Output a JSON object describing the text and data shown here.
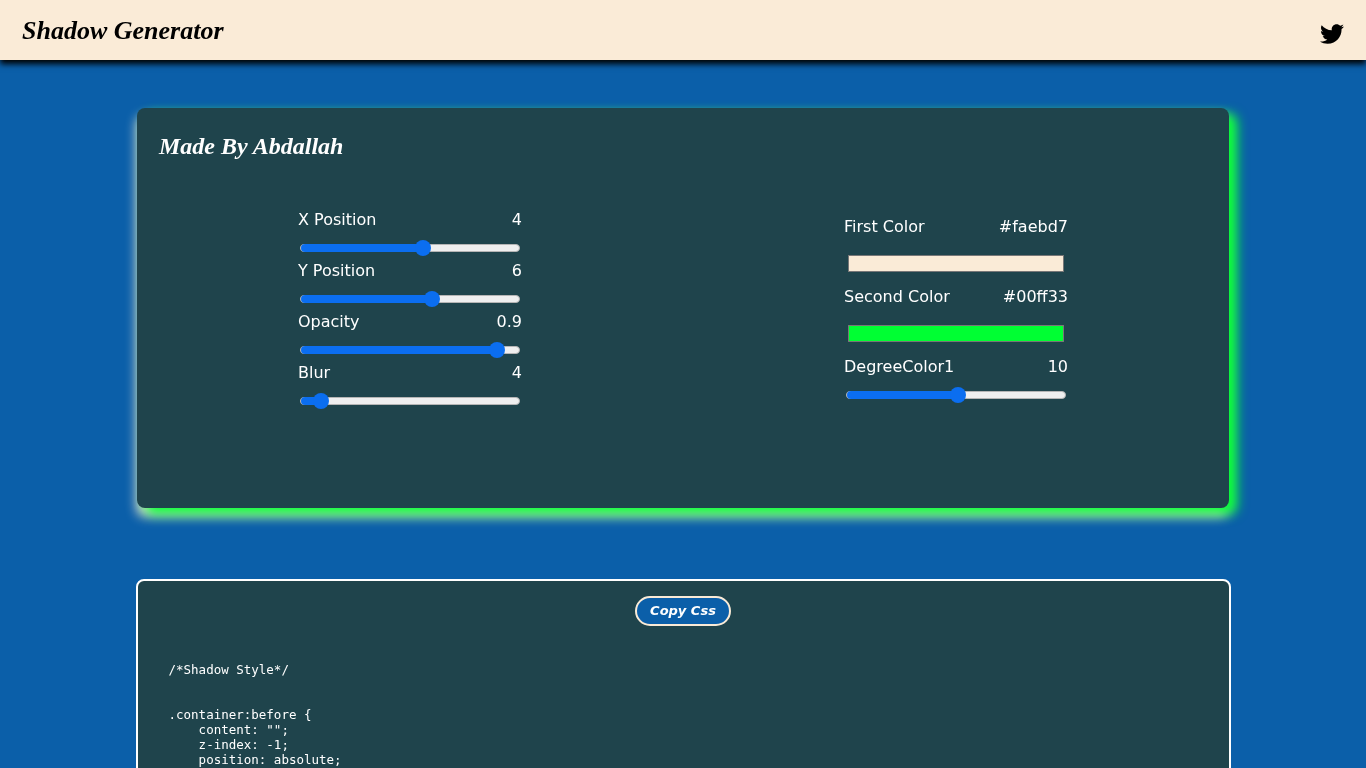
{
  "header": {
    "title": "Shadow Generator"
  },
  "card": {
    "title": "Made By Abdallah",
    "sliders": [
      {
        "label": "X Position",
        "reading": "4",
        "level": 0.56
      },
      {
        "label": "Y Position",
        "reading": "6",
        "level": 0.6
      },
      {
        "label": "Opacity",
        "reading": "0.9",
        "level": 0.9
      },
      {
        "label": "Blur",
        "reading": "4",
        "level": 0.09
      }
    ],
    "controls": [
      {
        "kind": "color",
        "label": "First Color",
        "reading": "#faebd7",
        "color": "#faebd7"
      },
      {
        "kind": "color",
        "label": "Second Color",
        "reading": "#00ff33",
        "color": "#00ff33"
      },
      {
        "kind": "slider",
        "label": "DegreeColor1",
        "reading": "10",
        "level": 0.51
      }
    ]
  },
  "code_panel": {
    "button": "Copy Css",
    "blocks": [
      [
        "/*Shadow Style*/"
      ],
      [
        ".container:before {",
        "    content: \"\";",
        "    z-index: -1;",
        "    position: absolute;"
      ]
    ]
  }
}
